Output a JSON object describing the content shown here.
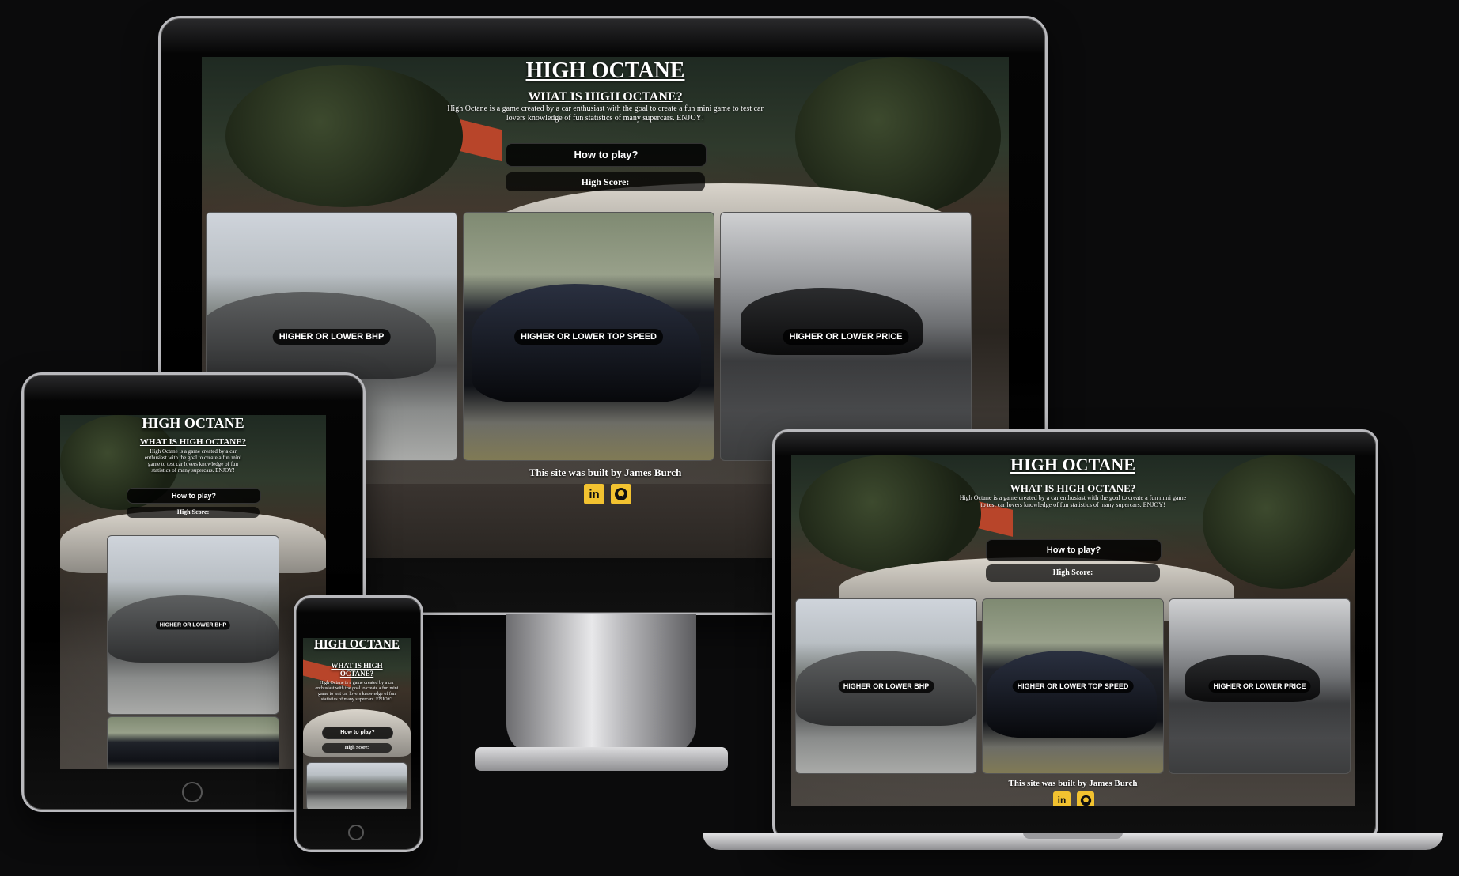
{
  "site": {
    "title": "HIGH OCTANE",
    "about_heading": "WHAT IS HIGH OCTANE?",
    "about_text": "High Octane is a game created by a car enthusiast with the goal to create a fun mini game to test car lovers knowledge of fun statistics of many supercars. ENJOY!",
    "how_to_play": "How to play?",
    "high_score_label": "High Score:",
    "modes": [
      {
        "label": "HIGHER OR LOWER BHP"
      },
      {
        "label": "HIGHER OR LOWER TOP SPEED"
      },
      {
        "label": "HIGHER OR LOWER PRICE"
      }
    ],
    "footer_text": "This site was built by James Burch",
    "social": [
      {
        "icon": "linkedin-icon",
        "label": "in"
      },
      {
        "icon": "github-icon"
      }
    ]
  },
  "colors": {
    "background": "#0b0b0c",
    "button_bg": "#000000",
    "social_icon": "#f2c230",
    "text": "#ffffff"
  }
}
